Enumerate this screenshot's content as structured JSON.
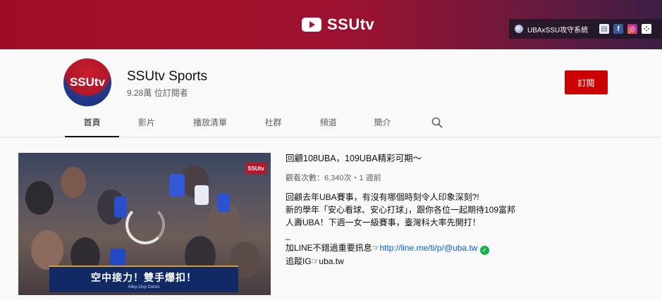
{
  "banner": {
    "title": "SSUtv",
    "links_text": "UBAxSSU攻守系統"
  },
  "channel": {
    "avatar_text": "SSUtv",
    "name": "SSUtv Sports",
    "subscribers": "9.28萬 位訂閱者",
    "subscribe_label": "訂閱"
  },
  "tabs": [
    {
      "label": "首頁",
      "active": true
    },
    {
      "label": "影片",
      "active": false
    },
    {
      "label": "播放清單",
      "active": false
    },
    {
      "label": "社群",
      "active": false
    },
    {
      "label": "頻道",
      "active": false
    },
    {
      "label": "簡介",
      "active": false
    }
  ],
  "featured_video": {
    "thumb_logo": "SSUtv",
    "caption_main": "空中接力！雙手爆扣！",
    "caption_sub": "Alley-Oop Dunks",
    "title": "回顧108UBA，109UBA精彩可期～",
    "meta": "觀看次數：6,340次・1 週前",
    "description": [
      "回顧去年UBA賽事，有沒有哪個時刻令人印象深刻?!",
      "新的學年「安心看球、安心打球」，跟你各位一起期待109富邦",
      "人壽UBA！下週一女一級賽事，臺灣科大率先開打！",
      "_"
    ],
    "line_prefix": "加LINE不錯過重要訊息☞",
    "line_url": "http://line.me/ti/p/@uba.tw",
    "ig_line": "追蹤IG☞uba.tw"
  },
  "colors": {
    "brand_red": "#cc0000",
    "link_blue": "#065fd4",
    "verified_green": "#14b14b"
  }
}
